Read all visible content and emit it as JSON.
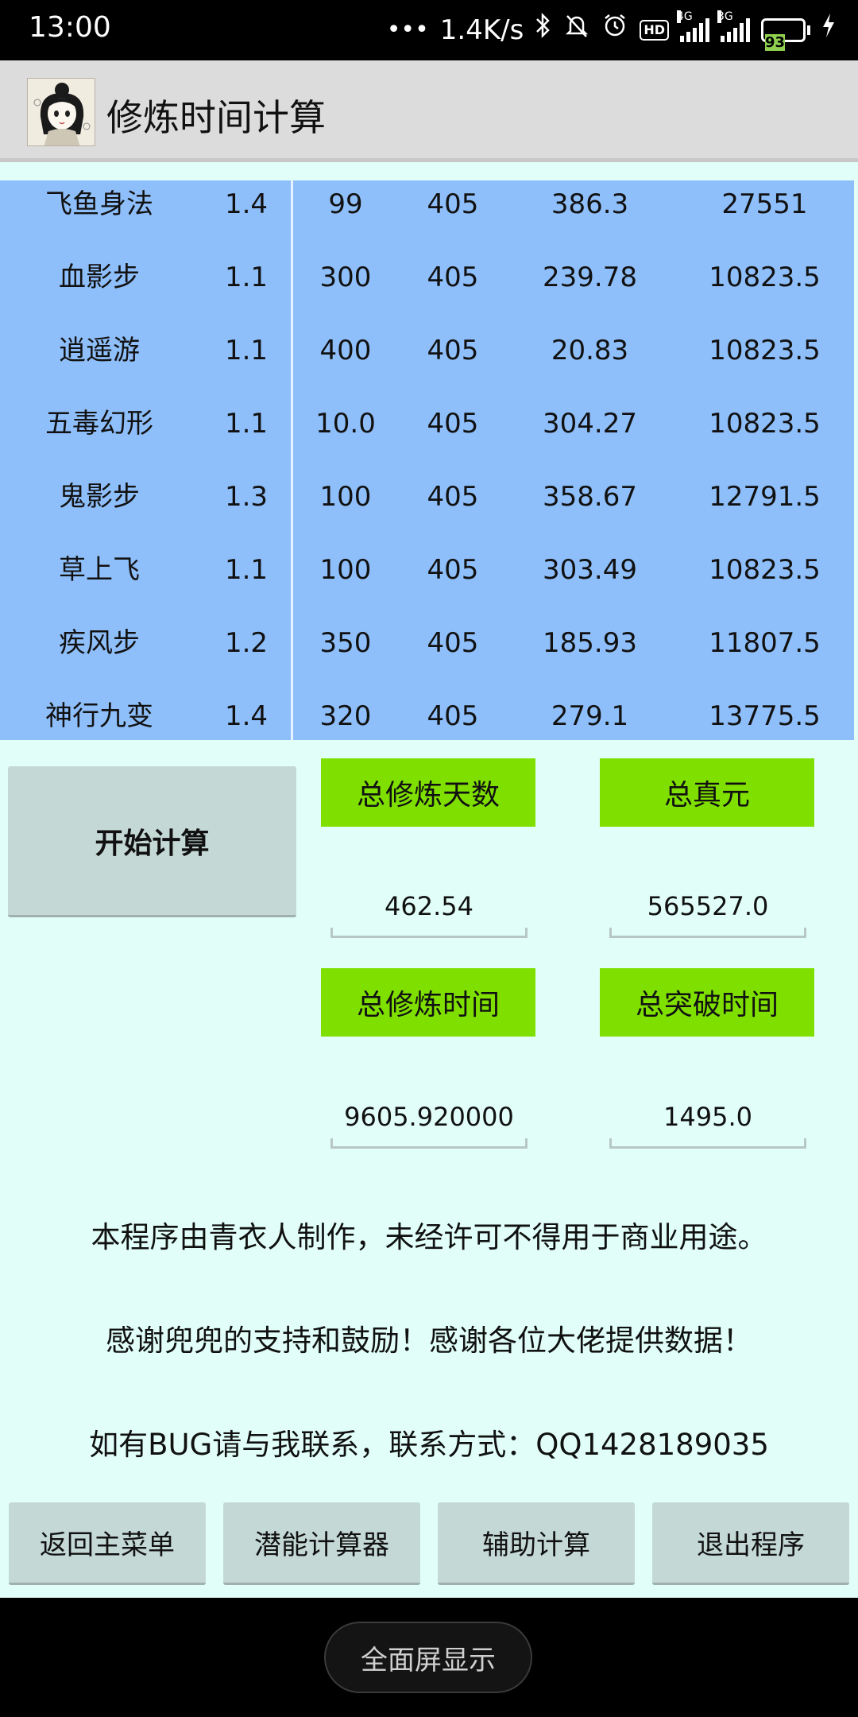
{
  "status_bar": {
    "time": "13:00",
    "net_speed": "1.4K/s",
    "sim1_tag": "4G",
    "sim2_tag": "3G",
    "hd_label": "HD",
    "battery": "93"
  },
  "app_bar": {
    "title": "修炼时间计算"
  },
  "table": {
    "rows": [
      {
        "name": "飞鱼身法",
        "mult": "1.4",
        "a": "99",
        "b": "405",
        "c": "386.3",
        "d": "27551"
      },
      {
        "name": "血影步",
        "mult": "1.1",
        "a": "300",
        "b": "405",
        "c": "239.78",
        "d": "10823.5"
      },
      {
        "name": "逍遥游",
        "mult": "1.1",
        "a": "400",
        "b": "405",
        "c": "20.83",
        "d": "10823.5"
      },
      {
        "name": "五毒幻形",
        "mult": "1.1",
        "a": "10.0",
        "b": "405",
        "c": "304.27",
        "d": "10823.5"
      },
      {
        "name": "鬼影步",
        "mult": "1.3",
        "a": "100",
        "b": "405",
        "c": "358.67",
        "d": "12791.5"
      },
      {
        "name": "草上飞",
        "mult": "1.1",
        "a": "100",
        "b": "405",
        "c": "303.49",
        "d": "10823.5"
      },
      {
        "name": "疾风步",
        "mult": "1.2",
        "a": "350",
        "b": "405",
        "c": "185.93",
        "d": "11807.5"
      },
      {
        "name": "神行九变",
        "mult": "1.4",
        "a": "320",
        "b": "405",
        "c": "279.1",
        "d": "13775.5"
      }
    ]
  },
  "calc": {
    "start_button": "开始计算",
    "total_days_label": "总修炼天数",
    "total_days_value": "462.54",
    "total_zhenyuan_label": "总真元",
    "total_zhenyuan_value": "565527.0",
    "total_time_label": "总修炼时间",
    "total_time_value": "9605.920000",
    "total_break_label": "总突破时间",
    "total_break_value": "1495.0"
  },
  "info": {
    "line1": "本程序由青衣人制作，未经许可不得用于商业用途。",
    "line2": "感谢兜兜的支持和鼓励！感谢各位大佬提供数据！",
    "line3": "如有BUG请与我联系，联系方式：QQ1428189035"
  },
  "bottom_buttons": {
    "back": "返回主菜单",
    "potential": "潜能计算器",
    "assist": "辅助计算",
    "exit": "退出程序"
  },
  "nav_bar": {
    "fullscreen": "全面屏显示"
  }
}
